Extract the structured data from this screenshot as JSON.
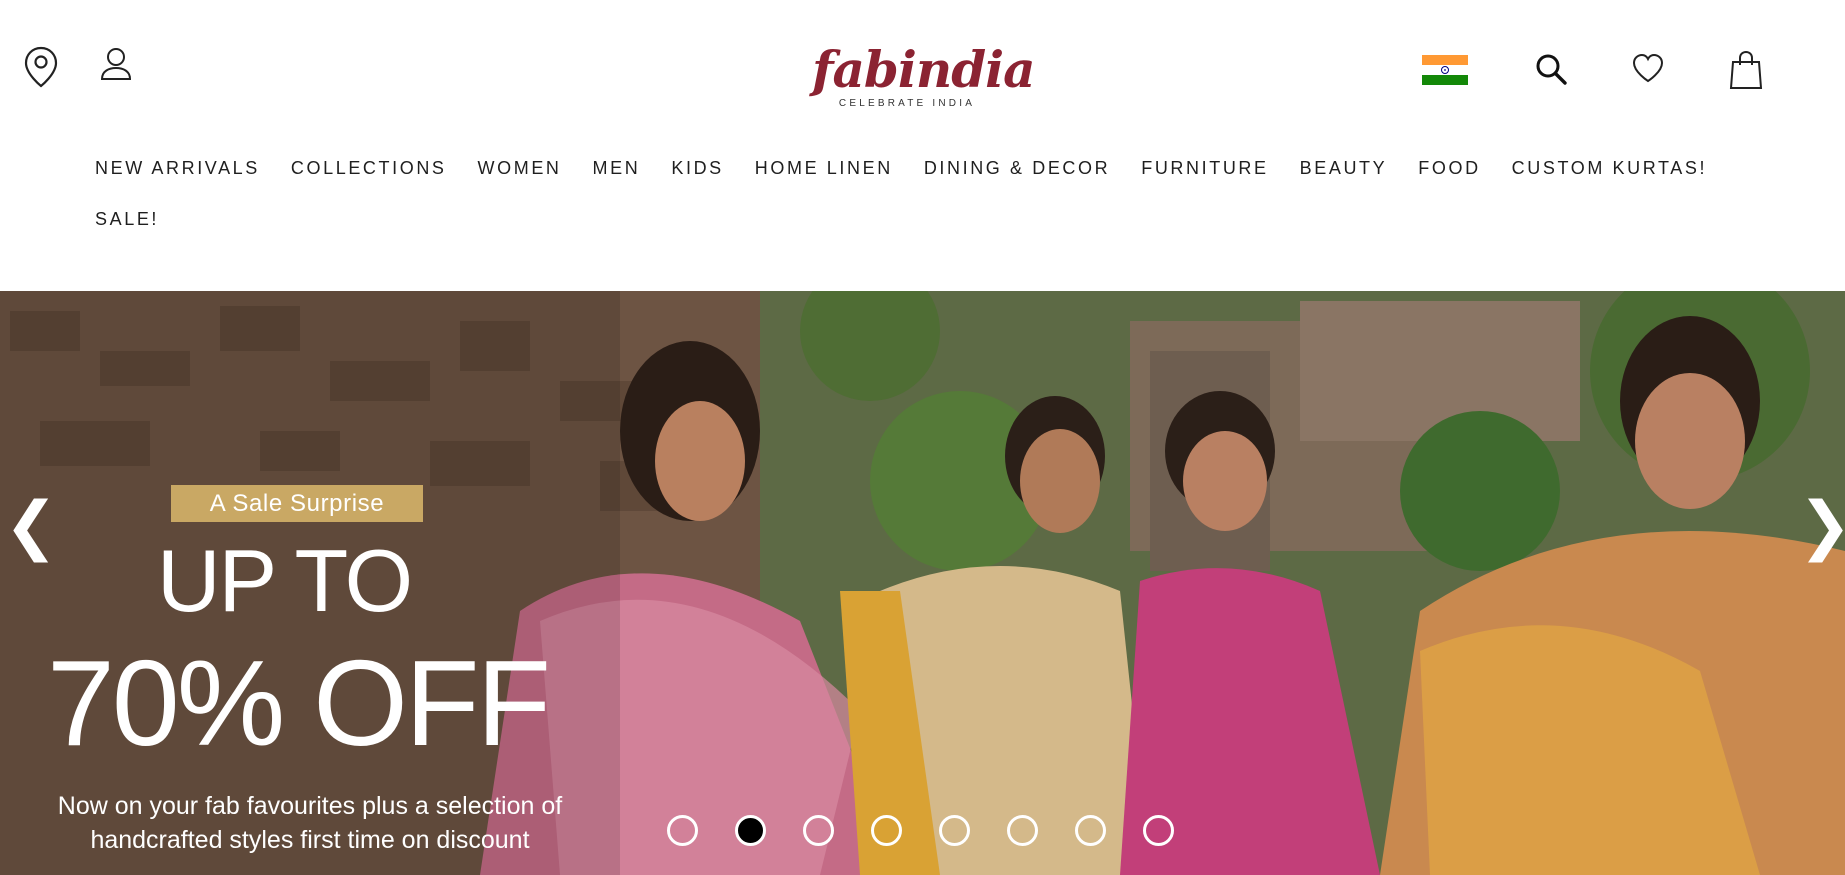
{
  "header": {
    "logo_word": "fabindia",
    "logo_tagline": "CELEBRATE INDIA",
    "icons": [
      "location-pin-icon",
      "user-icon",
      "india-flag-icon",
      "search-icon",
      "heart-icon",
      "shopping-bag-icon"
    ]
  },
  "nav": {
    "row1": [
      "NEW ARRIVALS",
      "COLLECTIONS",
      "WOMEN",
      "MEN",
      "KIDS",
      "HOME LINEN",
      "DINING & DECOR",
      "FURNITURE",
      "BEAUTY",
      "FOOD",
      "CUSTOM KURTAS!"
    ],
    "row2": [
      "SALE!"
    ]
  },
  "hero": {
    "badge": "A Sale Surprise",
    "headline_1": "UP TO",
    "headline_2": "70% OFF",
    "subtext": "Now on your fab favourites plus a selection of handcrafted styles first time on discount",
    "prev_arrow": "❮",
    "next_arrow": "❯",
    "slide_count": 8,
    "active_slide": 2
  },
  "colors": {
    "brand": "#8b2332",
    "badge": "#c9a864"
  }
}
